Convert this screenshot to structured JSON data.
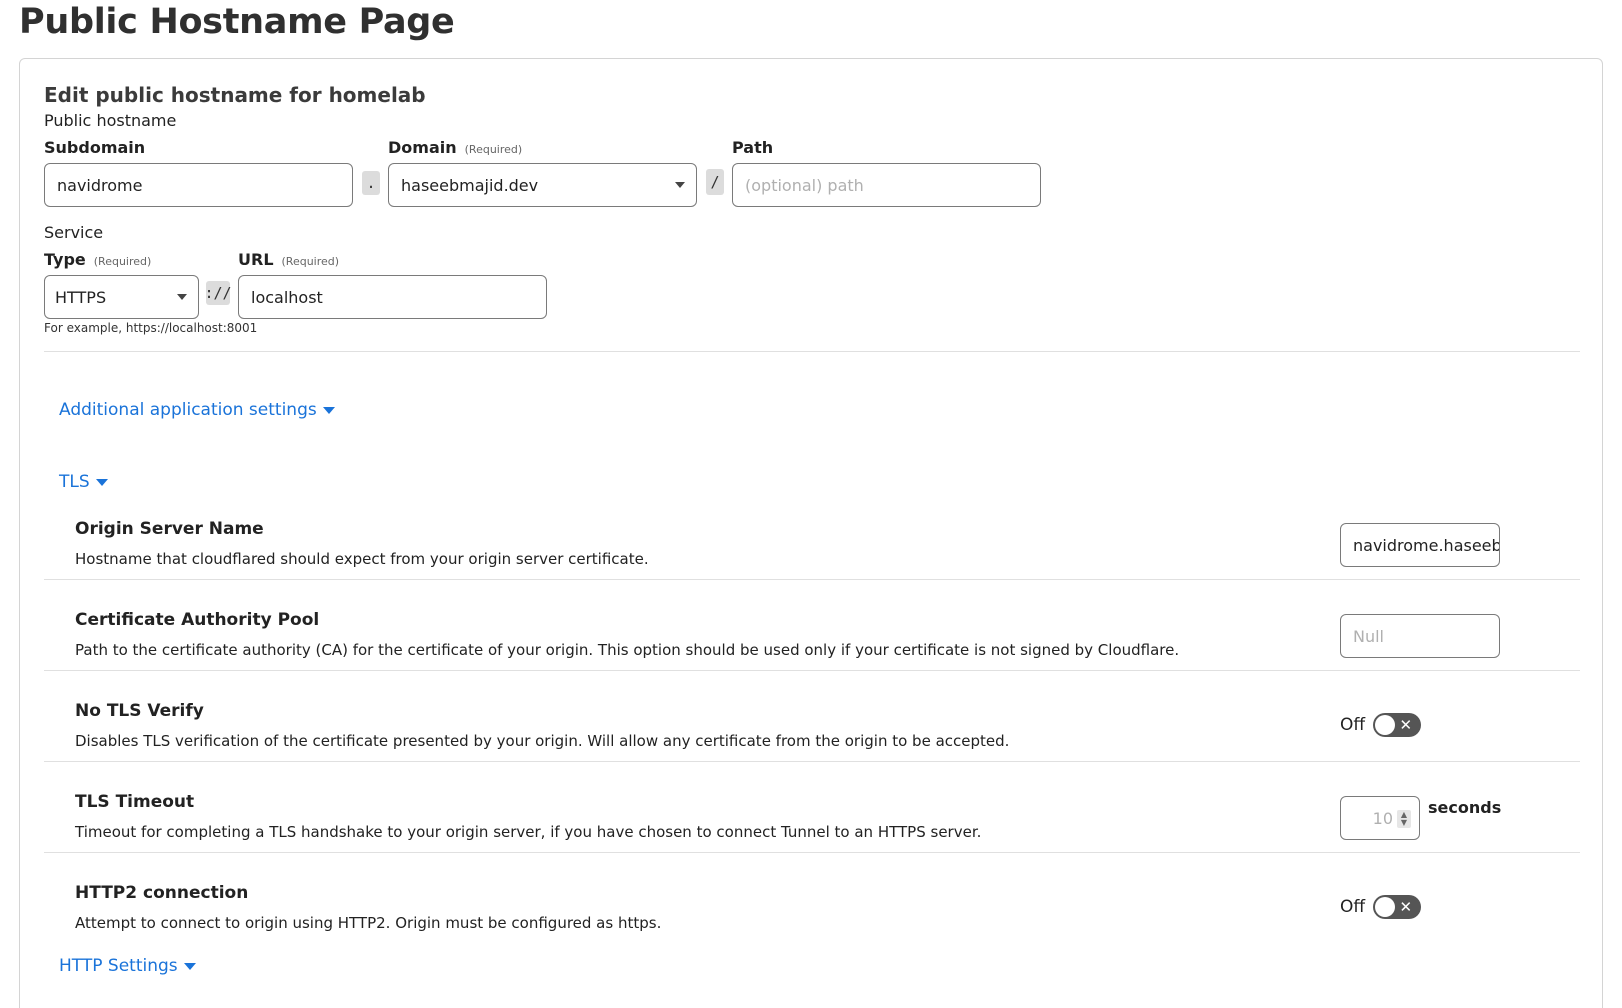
{
  "page_title": "Public Hostname Page",
  "card": {
    "heading": "Edit public hostname for homelab",
    "hostname_section": "Public hostname",
    "subdomain": {
      "label": "Subdomain",
      "value": "navidrome"
    },
    "dot_sep": ".",
    "domain": {
      "label": "Domain",
      "required": "(Required)",
      "value": "haseebmajid.dev"
    },
    "slash_sep": "/",
    "path": {
      "label": "Path",
      "placeholder": "(optional) path"
    },
    "service_section": "Service",
    "type": {
      "label": "Type",
      "required": "(Required)",
      "value": "HTTPS"
    },
    "scheme_sep": "://",
    "url": {
      "label": "URL",
      "required": "(Required)",
      "value": "localhost"
    },
    "url_hint": "For example, https://localhost:8001"
  },
  "additional_settings": {
    "label": "Additional application settings"
  },
  "tls": {
    "label": "TLS",
    "rows": [
      {
        "title": "Origin Server Name",
        "desc": "Hostname that cloudflared should expect from your origin server certificate.",
        "value": "navidrome.haseeb"
      },
      {
        "title": "Certificate Authority Pool",
        "desc": "Path to the certificate authority (CA) for the certificate of your origin. This option should be used only if your certificate is not signed by Cloudflare.",
        "placeholder": "Null"
      },
      {
        "title": "No TLS Verify",
        "desc": "Disables TLS verification of the certificate presented by your origin. Will allow any certificate from the origin to be accepted.",
        "toggle_label": "Off"
      },
      {
        "title": "TLS Timeout",
        "desc": "Timeout for completing a TLS handshake to your origin server, if you have chosen to connect Tunnel to an HTTPS server.",
        "value": "10",
        "unit": "seconds"
      },
      {
        "title": "HTTP2 connection",
        "desc": "Attempt to connect to origin using HTTP2. Origin must be configured as https.",
        "toggle_label": "Off"
      }
    ]
  },
  "http_settings": {
    "label": "HTTP Settings"
  },
  "icons": {
    "dropdown": "chevron-down-icon",
    "toggle_off": "close-icon"
  }
}
